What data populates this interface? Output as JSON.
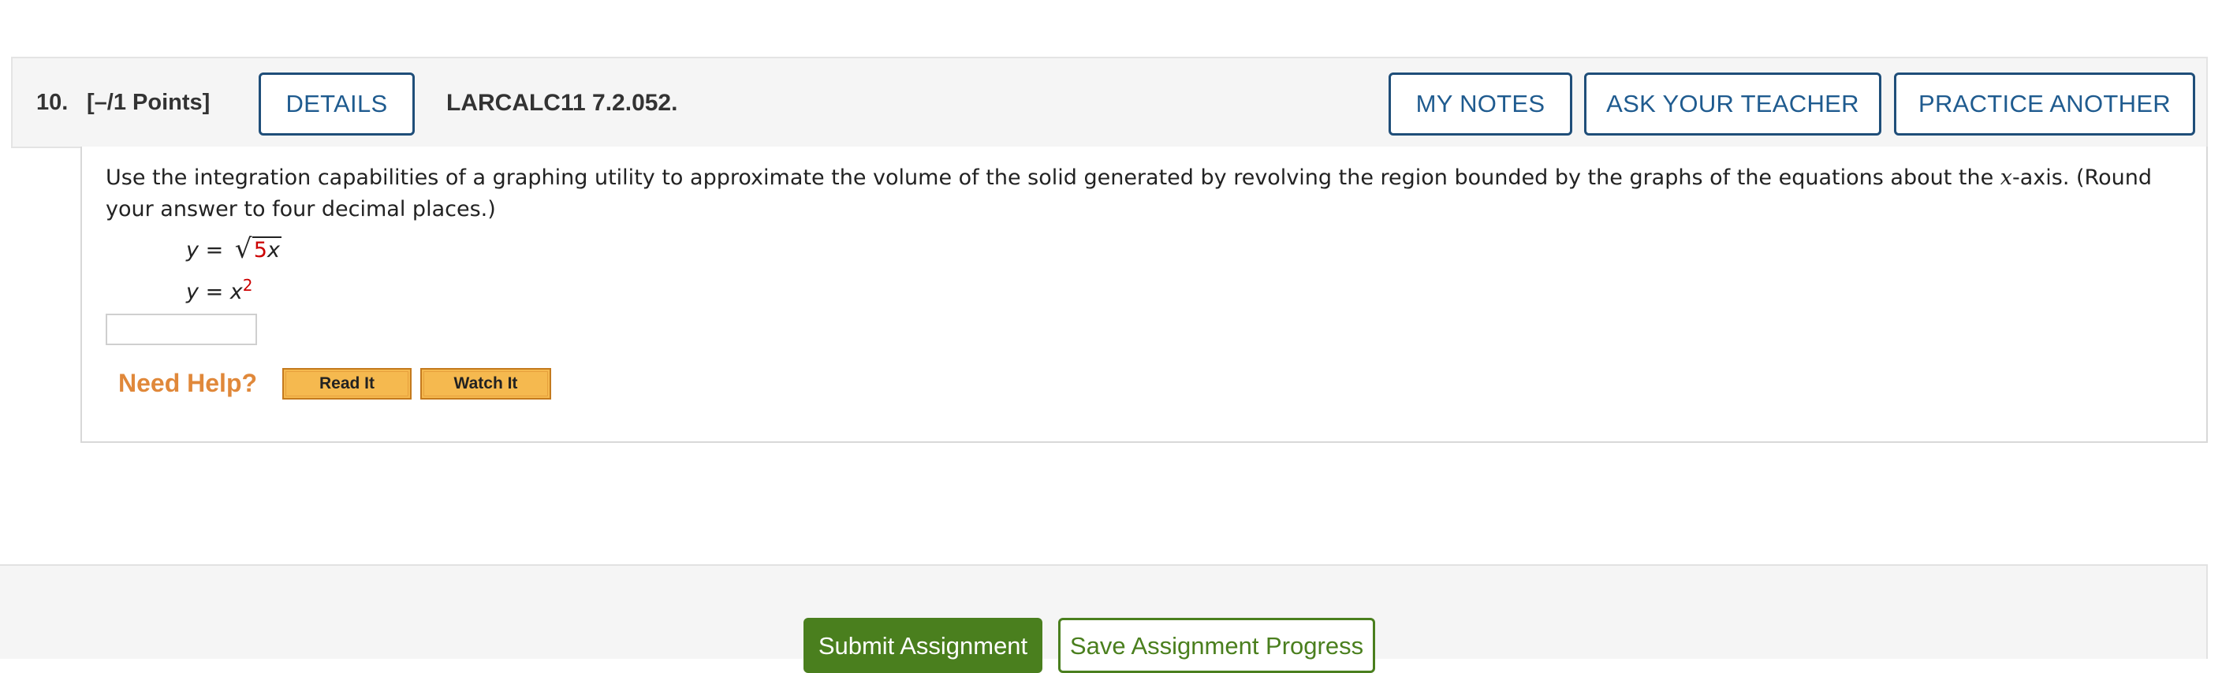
{
  "question": {
    "number": "10.",
    "points": "[–/1 Points]",
    "details_label": "DETAILS",
    "reference": "LARCALC11 7.2.052.",
    "my_notes_label": "MY NOTES",
    "ask_teacher_label": "ASK YOUR TEACHER",
    "practice_another_label": "PRACTICE ANOTHER"
  },
  "body": {
    "text_before": "Use the integration capabilities of a graphing utility to approximate the volume of the solid generated by revolving the region bounded by the graphs of the equations about the ",
    "text_var": "x",
    "text_after": "-axis. (Round your answer to four decimal places.)",
    "eq1": {
      "lhs": "y",
      "equals": " = ",
      "radicand_coef": "5",
      "radicand_var": "x"
    },
    "eq2": {
      "lhs": "y",
      "equals": " = ",
      "base": "x",
      "exponent": "2"
    },
    "answer_value": ""
  },
  "help": {
    "label": "Need Help?",
    "read_it": "Read It",
    "watch_it": "Watch It"
  },
  "footer": {
    "submit_label": "Submit Assignment",
    "save_label": "Save Assignment Progress"
  },
  "colors": {
    "link_blue": "#1f5b8f",
    "help_orange": "#e0883a",
    "submit_green": "#4a7f1e",
    "highlight_red": "#cc0000"
  }
}
